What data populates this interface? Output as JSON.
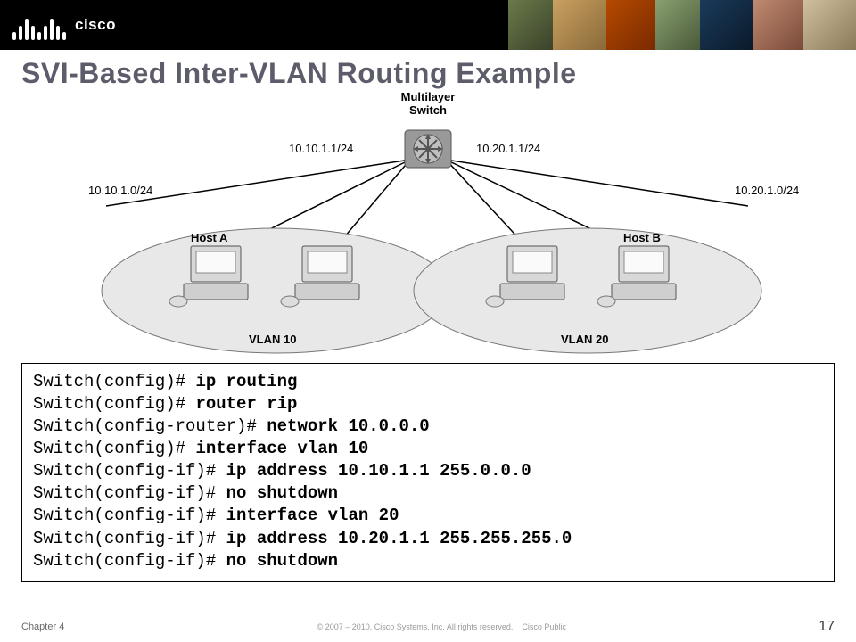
{
  "header": {
    "brand": "cisco"
  },
  "title": "SVI-Based Inter-VLAN Routing Example",
  "diagram": {
    "switch_label": "Multilayer\nSwitch",
    "ip_left_link": "10.10.1.1/24",
    "ip_right_link": "10.20.1.1/24",
    "net_left": "10.10.1.0/24",
    "net_right": "10.20.1.0/24",
    "host_a": "Host A",
    "host_b": "Host B",
    "vlan10": "VLAN 10",
    "vlan20": "VLAN 20"
  },
  "code": [
    {
      "prompt": "Switch(config)# ",
      "cmd": "ip routing"
    },
    {
      "prompt": "Switch(config)# ",
      "cmd": "router rip"
    },
    {
      "prompt": "Switch(config-router)# ",
      "cmd": "network 10.0.0.0"
    },
    {
      "prompt": "Switch(config)# ",
      "cmd": "interface vlan 10"
    },
    {
      "prompt": "Switch(config-if)# ",
      "cmd": "ip address 10.10.1.1 255.0.0.0"
    },
    {
      "prompt": "Switch(config-if)# ",
      "cmd": "no shutdown"
    },
    {
      "prompt": "Switch(config-if)# ",
      "cmd": "interface vlan 20"
    },
    {
      "prompt": "Switch(config-if)# ",
      "cmd": "ip address 10.20.1.1 255.255.255.0"
    },
    {
      "prompt": "Switch(config-if)# ",
      "cmd": "no shutdown"
    }
  ],
  "footer": {
    "chapter": "Chapter 4",
    "copyright": "© 2007 – 2010, Cisco Systems, Inc. All rights reserved.",
    "classification": "Cisco Public",
    "page": "17"
  }
}
